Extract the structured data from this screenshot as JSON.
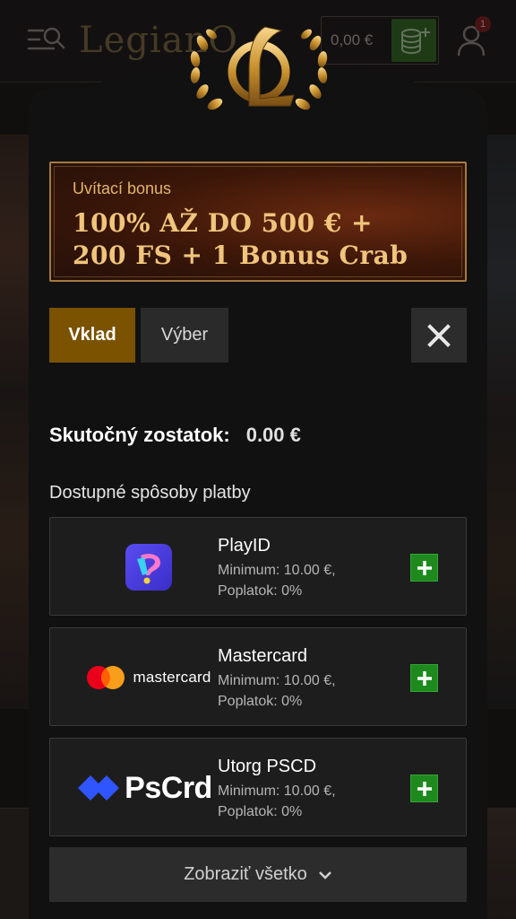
{
  "site_header": {
    "logo_text": "LegianO",
    "balance": "0,00 €",
    "notification_count": "1"
  },
  "bonus": {
    "label": "Uvítací bonus",
    "line1": "100% AŽ DO 500 € +",
    "line2": "200 FS + 1 Bonus Crab"
  },
  "tabs": {
    "deposit": "Vklad",
    "withdraw": "Výber"
  },
  "balance": {
    "label": "Skutočný zostatok:",
    "value": "0.00 €"
  },
  "methods_title": "Dostupné spôsoby platby",
  "methods": [
    {
      "name": "PlayID",
      "minimum": "Minimum: 10.00 €,",
      "fee": "Poplatok: 0%",
      "logo_text": ""
    },
    {
      "name": "Mastercard",
      "minimum": "Minimum: 10.00 €,",
      "fee": "Poplatok: 0%",
      "logo_text": "mastercard"
    },
    {
      "name": "Utorg PSCD",
      "minimum": "Minimum: 10.00 €,",
      "fee": "Poplatok: 0%",
      "logo_text": "PsCrd"
    }
  ],
  "show_all_label": "Zobraziť všetko",
  "colors": {
    "accent_gold": "#7a5200",
    "add_green": "#1e8a1e",
    "modal_bg": "#111111",
    "banner_text": "#f0c57c"
  },
  "icons": {
    "menu": "menu-search-icon",
    "wallet": "coins-plus-icon",
    "user": "user-icon",
    "close": "close-icon",
    "add": "plus-icon",
    "expand": "chevron-down-icon",
    "crest": "laurel-crest-icon"
  }
}
